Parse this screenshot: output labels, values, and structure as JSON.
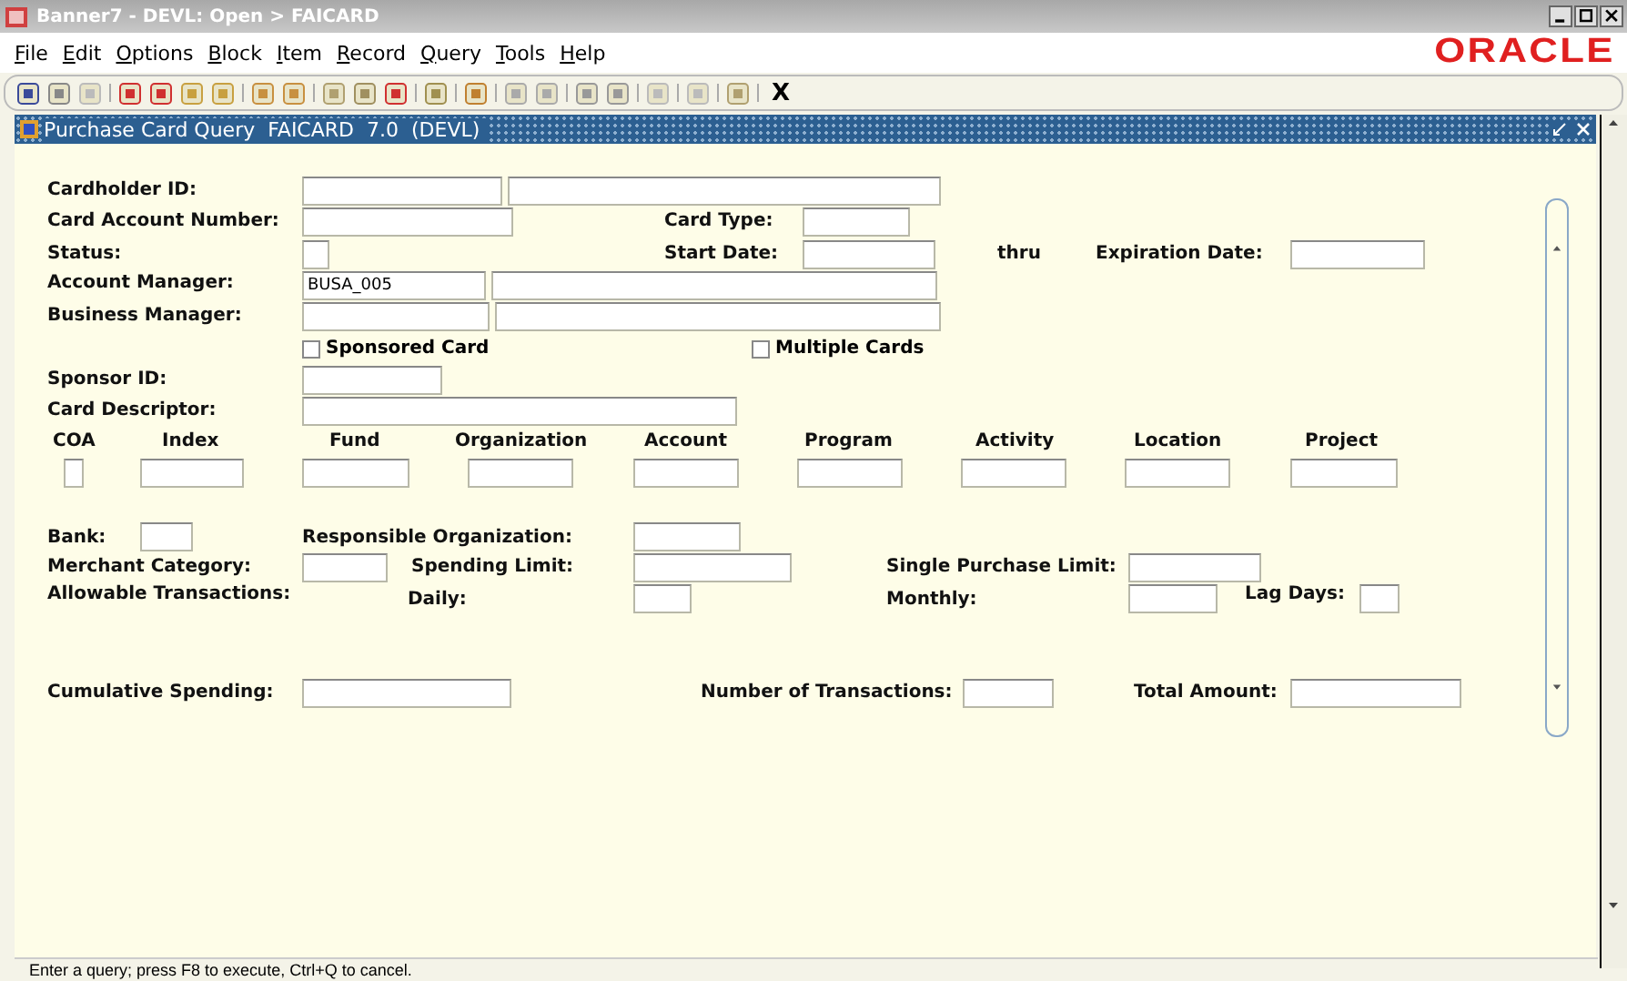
{
  "window": {
    "title": "Banner7 - DEVL: Open > FAICARD"
  },
  "menu": [
    "File",
    "Edit",
    "Options",
    "Block",
    "Item",
    "Record",
    "Query",
    "Tools",
    "Help"
  ],
  "brand": "ORACLE",
  "toolbar": {
    "exit_label": "X"
  },
  "form": {
    "title": "Purchase Card Query  FAICARD  7.0  (DEVL)",
    "labels": [
      "Cardholder ID:",
      "Card Account Number:",
      "Card Type:",
      "Status:",
      "Start Date:",
      "thru",
      "Expiration Date:",
      "Account Manager:",
      "Business Manager:",
      "Sponsor ID:",
      "Card Descriptor:",
      "COA",
      "Index",
      "Fund",
      "Organization",
      "Account",
      "Program",
      "Activity",
      "Location",
      "Project",
      "Bank:",
      "Responsible Organization:",
      "Merchant Category:",
      "Spending Limit:",
      "Single Purchase Limit:",
      "Allowable Transactions:",
      "Daily:",
      "Monthly:",
      "Lag Days:",
      "Cumulative Spending:",
      "Number of Transactions:",
      "Total Amount:"
    ],
    "account_manager_value": "BUSA_005",
    "checkboxes": [
      {
        "label": "Sponsored Card",
        "checked": false
      },
      {
        "label": "Multiple Cards",
        "checked": false
      }
    ]
  },
  "status_bar": "Enter a query;  press F8 to execute, Ctrl+Q to cancel."
}
